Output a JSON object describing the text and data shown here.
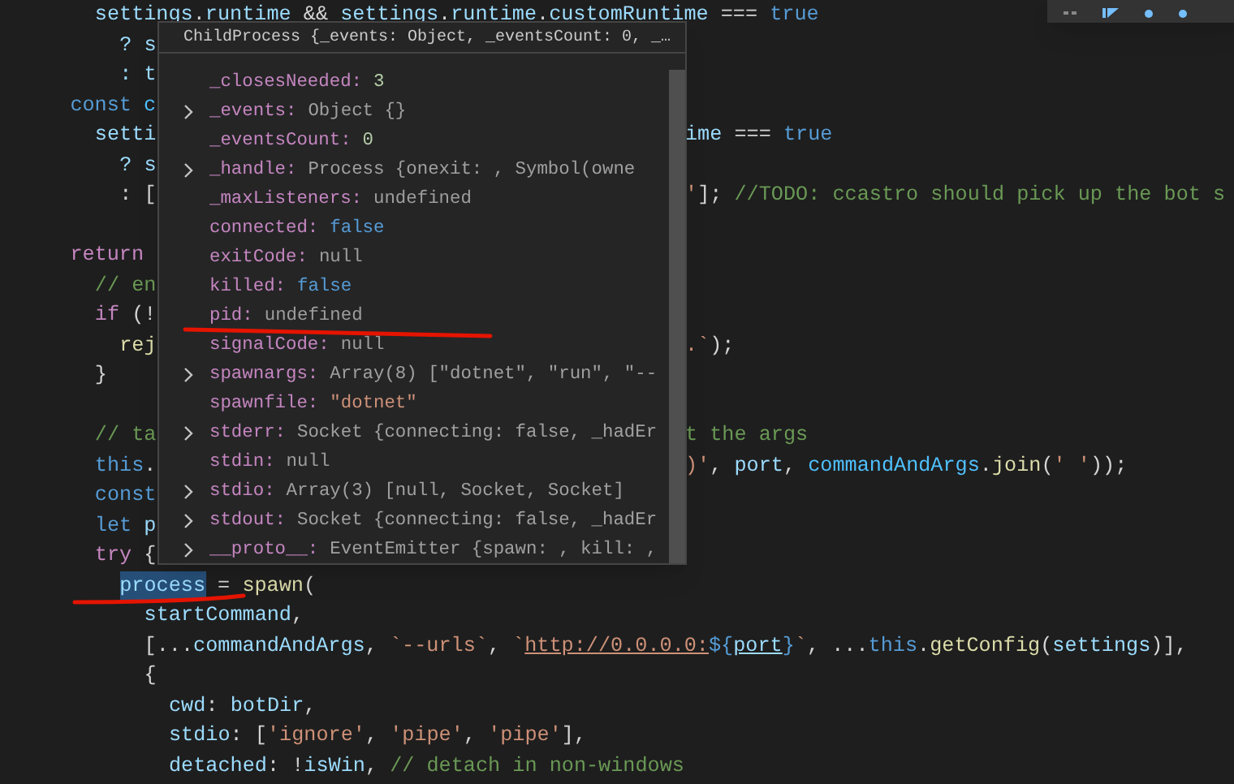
{
  "code_lines": [
    {
      "kind": "offscreen-parent",
      "children": [
        {
          "kind": "code",
          "tokens": [
            {
              "t": "settings",
              "kind": "var"
            },
            {
              "t": ".",
              "kind": "punct"
            },
            {
              "t": "runtime",
              "kind": "var"
            },
            {
              "t": " && ",
              "kind": "punct"
            },
            {
              "t": "settings",
              "kind": "var"
            },
            {
              "t": ".",
              "kind": "punct"
            },
            {
              "t": "runtime",
              "kind": "var"
            },
            {
              "t": ".",
              "kind": "punct"
            },
            {
              "t": "customRuntime",
              "kind": "var"
            },
            {
              "t": " === ",
              "kind": "punct"
            },
            {
              "t": "true",
              "kind": "keyword"
            }
          ],
          "children": [
            {
              "kind": "code",
              "tokens": [
                {
                  "t": "? s",
                  "kind": "var"
                }
              ]
            },
            {
              "kind": "code",
              "tokens": [
                {
                  "t": ": t",
                  "kind": "var"
                }
              ]
            }
          ]
        }
      ]
    },
    {
      "kind": "code",
      "tokens": [
        {
          "t": "const",
          "kind": "keyword"
        },
        {
          "t": " c",
          "kind": "const"
        }
      ],
      "children": [
        {
          "kind": "code",
          "tokens": [
            {
              "t": "setti",
              "kind": "var"
            }
          ],
          "right": [
            {
              "t": "ime",
              "kind": "var"
            },
            {
              "t": " === ",
              "kind": "punct"
            },
            {
              "t": "true",
              "kind": "keyword"
            }
          ],
          "children": [
            {
              "kind": "code",
              "tokens": [
                {
                  "t": "? s",
                  "kind": "var"
                }
              ]
            },
            {
              "kind": "code",
              "tokens": [
                {
                  "t": ": [",
                  "kind": "punct"
                }
              ],
              "right": [
                {
                  "t": "'",
                  "kind": "string"
                },
                {
                  "t": "]; ",
                  "kind": "punct"
                },
                {
                  "t": "//TODO: ccastro should pick up the bot s",
                  "kind": "comment"
                }
              ]
            }
          ]
        }
      ]
    },
    {
      "kind": "blank"
    },
    {
      "kind": "code",
      "tokens": [
        {
          "t": "return",
          "kind": "control"
        }
      ],
      "children": [
        {
          "kind": "code",
          "tokens": [
            {
              "t": "// en",
              "kind": "comment"
            }
          ]
        },
        {
          "kind": "code",
          "tokens": [
            {
              "t": "if",
              "kind": "control"
            },
            {
              "t": " (!",
              "kind": "punct"
            }
          ],
          "children": [
            {
              "kind": "code",
              "tokens": [
                {
                  "t": "rej",
                  "kind": "func"
                }
              ],
              "right": [
                {
                  "t": ".`",
                  "kind": "string"
                },
                {
                  "t": ");",
                  "kind": "punct"
                }
              ]
            }
          ]
        },
        {
          "kind": "code",
          "tokens": [
            {
              "t": "}",
              "kind": "punct"
            }
          ]
        },
        {
          "kind": "blank"
        },
        {
          "kind": "code",
          "tokens": [
            {
              "t": "// ta",
              "kind": "comment"
            }
          ],
          "right": [
            {
              "t": "t the args",
              "kind": "comment"
            }
          ]
        },
        {
          "kind": "code",
          "tokens": [
            {
              "t": "this",
              "kind": "keyword"
            },
            {
              "t": ".",
              "kind": "punct"
            }
          ],
          "right": [
            {
              "t": ")'",
              "kind": "string"
            },
            {
              "t": ", ",
              "kind": "punct"
            },
            {
              "t": "port",
              "kind": "var"
            },
            {
              "t": ", ",
              "kind": "punct"
            },
            {
              "t": "commandAndArgs",
              "kind": "const"
            },
            {
              "t": ".",
              "kind": "punct"
            },
            {
              "t": "join",
              "kind": "func"
            },
            {
              "t": "(",
              "kind": "punct"
            },
            {
              "t": "' '",
              "kind": "string"
            },
            {
              "t": "));",
              "kind": "punct"
            }
          ]
        },
        {
          "kind": "code",
          "tokens": [
            {
              "t": "const",
              "kind": "keyword"
            }
          ]
        },
        {
          "kind": "code",
          "tokens": [
            {
              "t": "let",
              "kind": "keyword"
            },
            {
              "t": " p",
              "kind": "var"
            }
          ]
        },
        {
          "kind": "code",
          "tokens": [
            {
              "t": "try",
              "kind": "control"
            },
            {
              "t": " {",
              "kind": "punct"
            }
          ],
          "children": [
            {
              "kind": "code",
              "tokens": [
                {
                  "t": "process",
                  "kind": "selected-var"
                },
                {
                  "t": " = ",
                  "kind": "punct"
                },
                {
                  "t": "spawn",
                  "kind": "func"
                },
                {
                  "t": "(",
                  "kind": "punct"
                }
              ],
              "children": [
                {
                  "kind": "code",
                  "tokens": [
                    {
                      "t": "startCommand",
                      "kind": "var"
                    },
                    {
                      "t": ",",
                      "kind": "punct"
                    }
                  ]
                },
                {
                  "kind": "code",
                  "tokens": [
                    {
                      "t": "[...",
                      "kind": "punct"
                    },
                    {
                      "t": "commandAndArgs",
                      "kind": "var"
                    },
                    {
                      "t": ", ",
                      "kind": "punct"
                    },
                    {
                      "t": "`--urls`",
                      "kind": "string"
                    },
                    {
                      "t": ", ",
                      "kind": "punct"
                    },
                    {
                      "t": "`",
                      "kind": "string"
                    },
                    {
                      "t": "http://0.0.0.0:",
                      "kind": "link"
                    },
                    {
                      "t": "${",
                      "kind": "keyword"
                    },
                    {
                      "t": "port",
                      "kind": "link-var"
                    },
                    {
                      "t": "}",
                      "kind": "keyword"
                    },
                    {
                      "t": "`",
                      "kind": "string"
                    },
                    {
                      "t": ", ...",
                      "kind": "punct"
                    },
                    {
                      "t": "this",
                      "kind": "keyword"
                    },
                    {
                      "t": ".",
                      "kind": "punct"
                    },
                    {
                      "t": "getConfig",
                      "kind": "func"
                    },
                    {
                      "t": "(",
                      "kind": "punct"
                    },
                    {
                      "t": "settings",
                      "kind": "var"
                    },
                    {
                      "t": ")],",
                      "kind": "punct"
                    }
                  ]
                },
                {
                  "kind": "code",
                  "tokens": [
                    {
                      "t": "{",
                      "kind": "punct"
                    }
                  ],
                  "children": [
                    {
                      "kind": "code",
                      "tokens": [
                        {
                          "t": "cwd",
                          "kind": "var"
                        },
                        {
                          "t": ": ",
                          "kind": "punct"
                        },
                        {
                          "t": "botDir",
                          "kind": "var"
                        },
                        {
                          "t": ",",
                          "kind": "punct"
                        }
                      ]
                    },
                    {
                      "kind": "code",
                      "tokens": [
                        {
                          "t": "stdio",
                          "kind": "var"
                        },
                        {
                          "t": ": [",
                          "kind": "punct"
                        },
                        {
                          "t": "'ignore'",
                          "kind": "string"
                        },
                        {
                          "t": ", ",
                          "kind": "punct"
                        },
                        {
                          "t": "'pipe'",
                          "kind": "string"
                        },
                        {
                          "t": ", ",
                          "kind": "punct"
                        },
                        {
                          "t": "'pipe'",
                          "kind": "string"
                        },
                        {
                          "t": "],",
                          "kind": "punct"
                        }
                      ]
                    },
                    {
                      "kind": "code",
                      "tokens": [
                        {
                          "t": "detached",
                          "kind": "var"
                        },
                        {
                          "t": ": !",
                          "kind": "punct"
                        },
                        {
                          "t": "isWin",
                          "kind": "var"
                        },
                        {
                          "t": ", ",
                          "kind": "punct"
                        },
                        {
                          "t": "// detach in non-windows",
                          "kind": "comment"
                        }
                      ]
                    }
                  ]
                }
              ]
            }
          ]
        }
      ]
    }
  ],
  "hover": {
    "title": "ChildProcess {_events: Object, _eventsCount: 0, _…",
    "rows": [
      {
        "name": "_closesNeeded:",
        "value": "3",
        "kind": "number",
        "expandable": false
      },
      {
        "name": "_events:",
        "value": "Object {}",
        "kind": "object",
        "expandable": true
      },
      {
        "name": "_eventsCount:",
        "value": "0",
        "kind": "number",
        "expandable": false
      },
      {
        "name": "_handle:",
        "value": "Process {onexit: , Symbol(owne",
        "kind": "object",
        "expandable": true
      },
      {
        "name": "_maxListeners:",
        "value": "undefined",
        "kind": "empty",
        "expandable": false
      },
      {
        "name": "connected:",
        "value": "false",
        "kind": "boolean",
        "expandable": false
      },
      {
        "name": "exitCode:",
        "value": "null",
        "kind": "empty",
        "expandable": false
      },
      {
        "name": "killed:",
        "value": "false",
        "kind": "boolean",
        "expandable": false
      },
      {
        "name": "pid:",
        "value": "undefined",
        "kind": "empty",
        "expandable": false
      },
      {
        "name": "signalCode:",
        "value": "null",
        "kind": "empty",
        "expandable": false
      },
      {
        "name": "spawnargs:",
        "value": "Array(8) [\"dotnet\", \"run\", \"--",
        "kind": "object",
        "expandable": true
      },
      {
        "name": "spawnfile:",
        "value": "\"dotnet\"",
        "kind": "string",
        "expandable": false
      },
      {
        "name": "stderr:",
        "value": "Socket {connecting: false, _hadEr",
        "kind": "object",
        "expandable": true
      },
      {
        "name": "stdin:",
        "value": "null",
        "kind": "empty",
        "expandable": false
      },
      {
        "name": "stdio:",
        "value": "Array(3) [null, Socket, Socket]",
        "kind": "object",
        "expandable": true
      },
      {
        "name": "stdout:",
        "value": "Socket {connecting: false, _hadEr",
        "kind": "object",
        "expandable": true
      },
      {
        "name": "__proto__:",
        "value": "EventEmitter {spawn: , kill: ,",
        "kind": "object",
        "expandable": true
      }
    ]
  }
}
